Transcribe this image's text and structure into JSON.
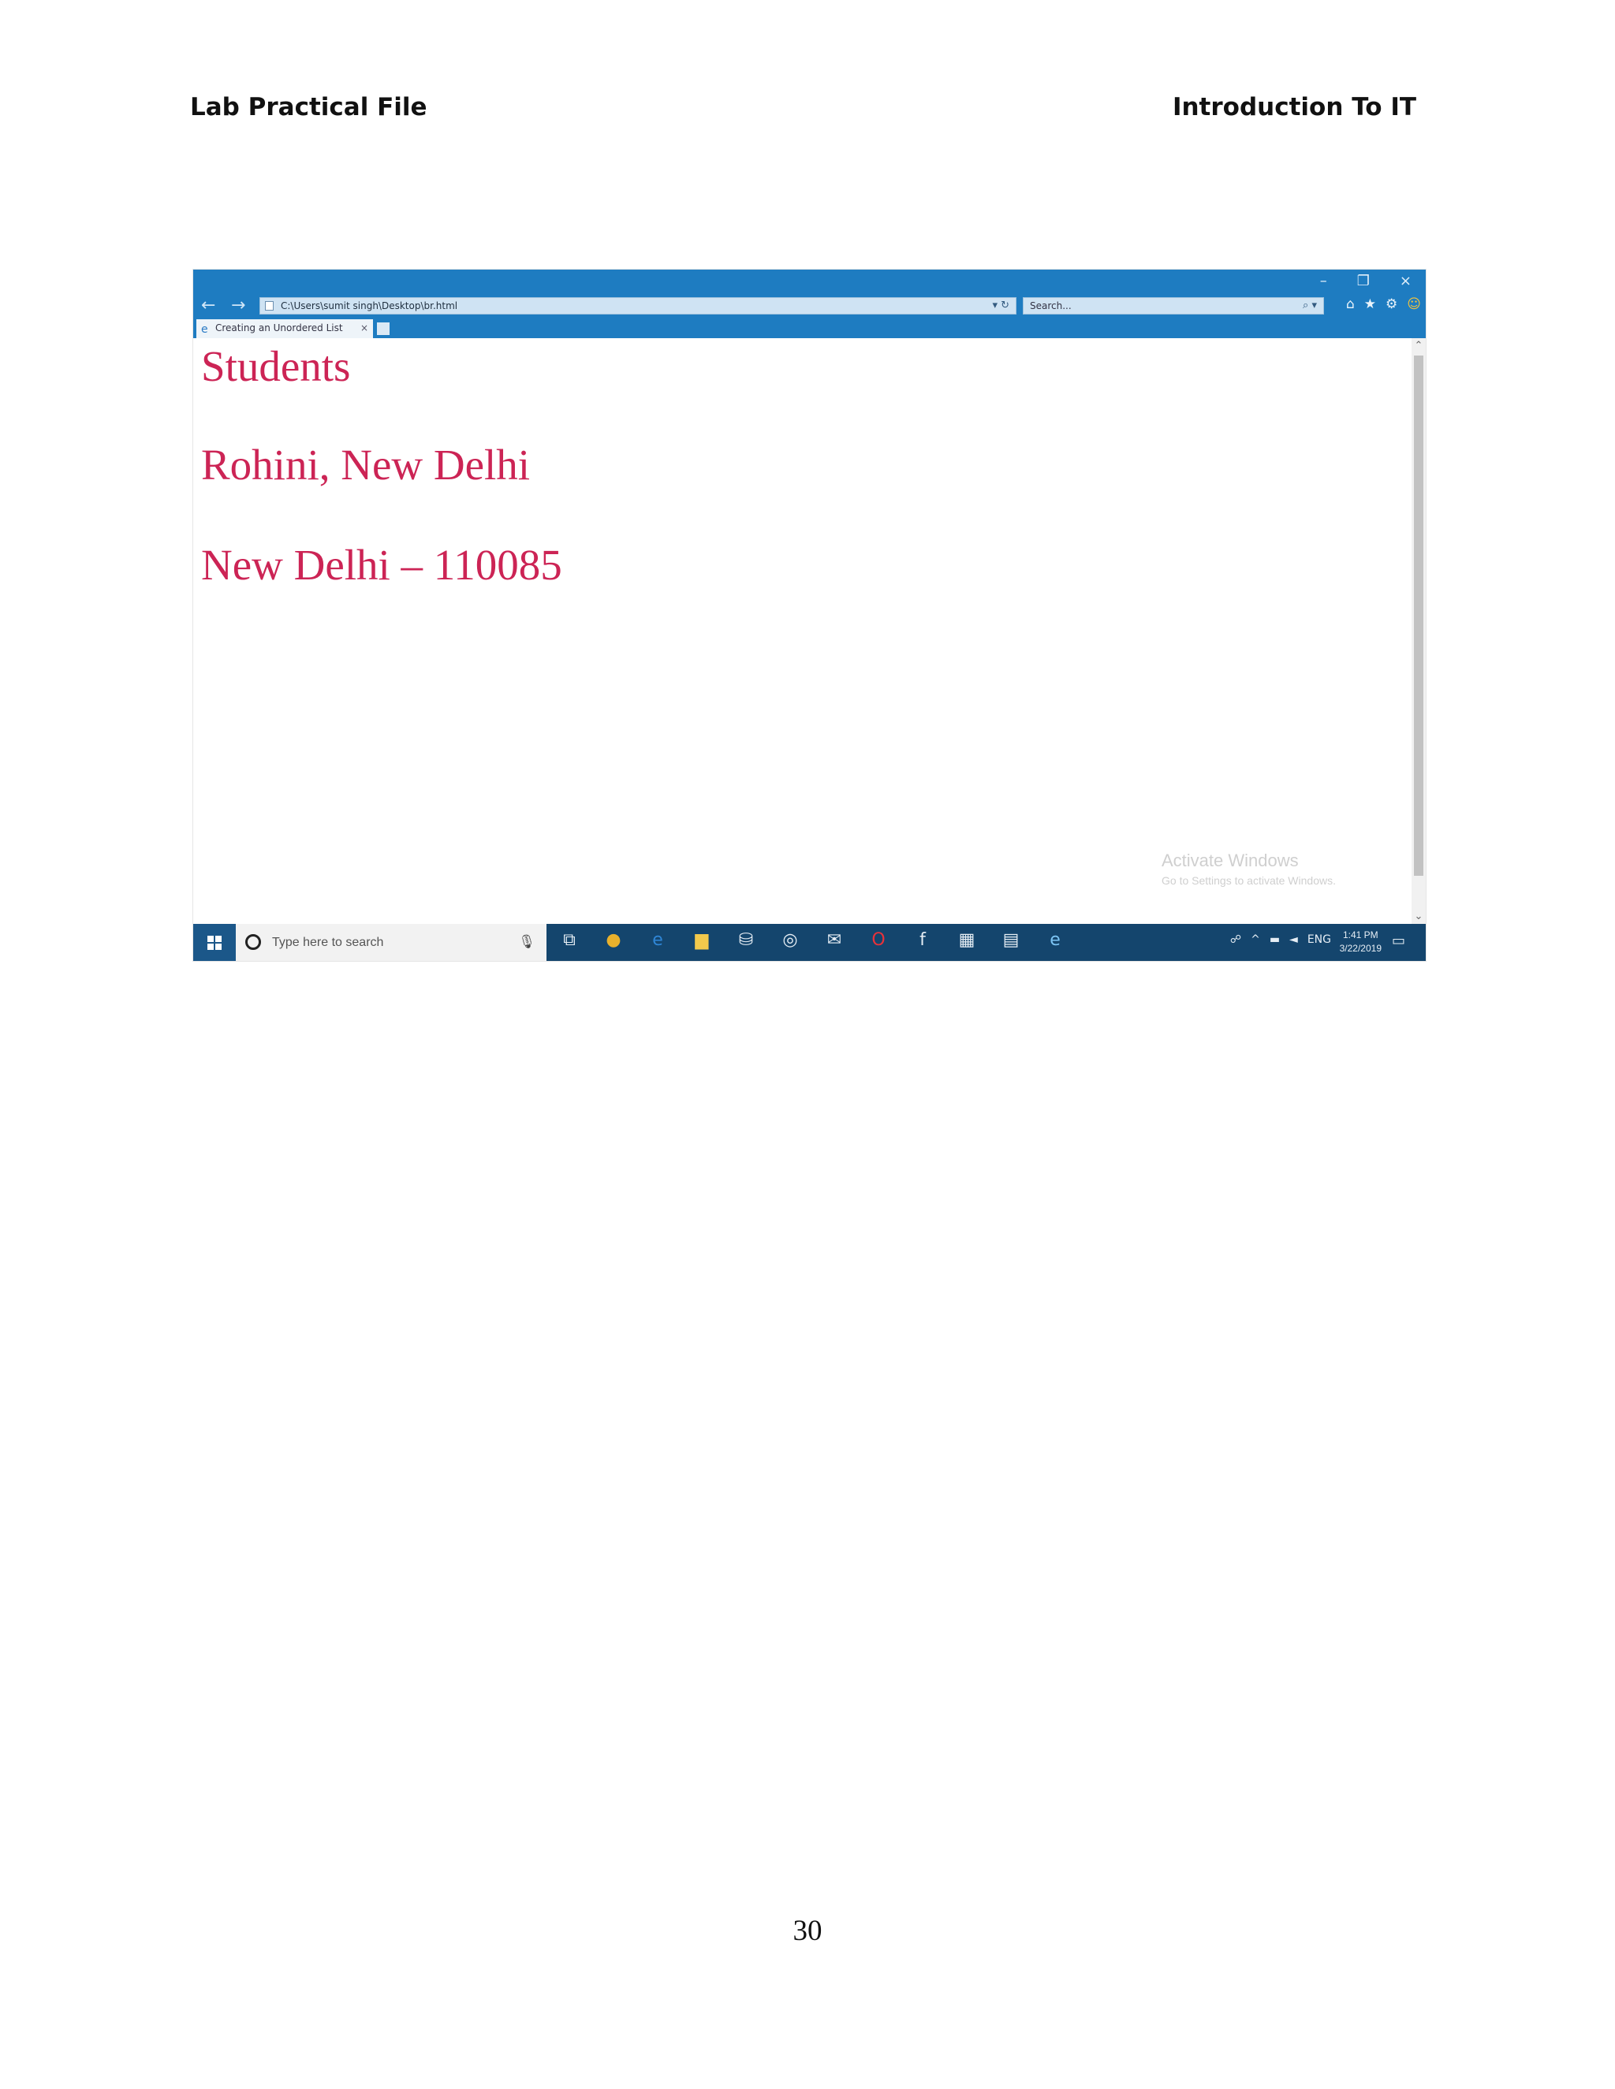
{
  "header": {
    "left_title": "Lab Practical File",
    "right_title": "Introduction To IT"
  },
  "browser": {
    "window_controls": {
      "minimize": "–",
      "restore": "❐",
      "close": "×"
    },
    "nav": {
      "back": "←",
      "forward": "→"
    },
    "address": "C:\\Users\\sumit singh\\Desktop\\br.html",
    "address_buttons": "▾ ↻",
    "search_placeholder": "Search...",
    "search_icon": "⌕ ▾",
    "toolbar_icons": {
      "home": "⌂",
      "favorites": "★",
      "settings": "⚙",
      "smiley": "☺"
    },
    "tab": {
      "title": "Creating an Unordered List",
      "close": "×"
    },
    "content": {
      "lines": [
        "Students",
        "Rohini, New Delhi",
        "New Delhi – 110085"
      ],
      "text_color": "#cc2455"
    },
    "watermark": {
      "title": "Activate Windows",
      "subtitle": "Go to Settings to activate Windows."
    },
    "scrollbar": {
      "up": "⌃",
      "down": "⌄"
    }
  },
  "taskbar": {
    "search_placeholder": "Type here to search",
    "mic_icon": "🎙",
    "app_icons": [
      "task-view",
      "chrome",
      "edge",
      "file-explorer",
      "store",
      "groove",
      "mail",
      "opera",
      "facebook",
      "calculator",
      "onenote",
      "internet-explorer"
    ],
    "tray_text": "ENG",
    "time": "1:41 PM",
    "date": "3/22/2019",
    "notif_icon": "▭"
  },
  "page_number": "30"
}
